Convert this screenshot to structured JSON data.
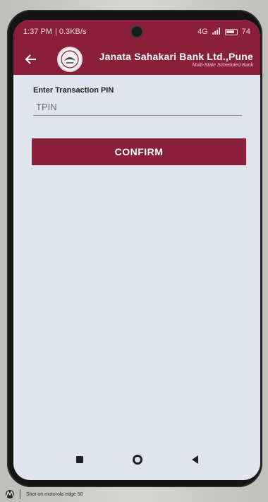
{
  "status_bar": {
    "time": "1:37 PM",
    "speed": "| 0.3KB/s",
    "network": "4G",
    "battery": "74"
  },
  "header": {
    "bank_name": "Janata Sahakari Bank Ltd.,Pune",
    "bank_tagline": "Multi-State Scheduled Bank",
    "back_icon": "arrow-left-icon"
  },
  "form": {
    "pin_label": "Enter Transaction PIN",
    "pin_placeholder": "TPIN",
    "pin_value": "",
    "confirm_label": "CONFIRM"
  },
  "watermark": {
    "text": "Shot on motorola edge 50"
  },
  "colors": {
    "brand": "#8a1f3a",
    "screen_bg": "#dfe4ee"
  }
}
